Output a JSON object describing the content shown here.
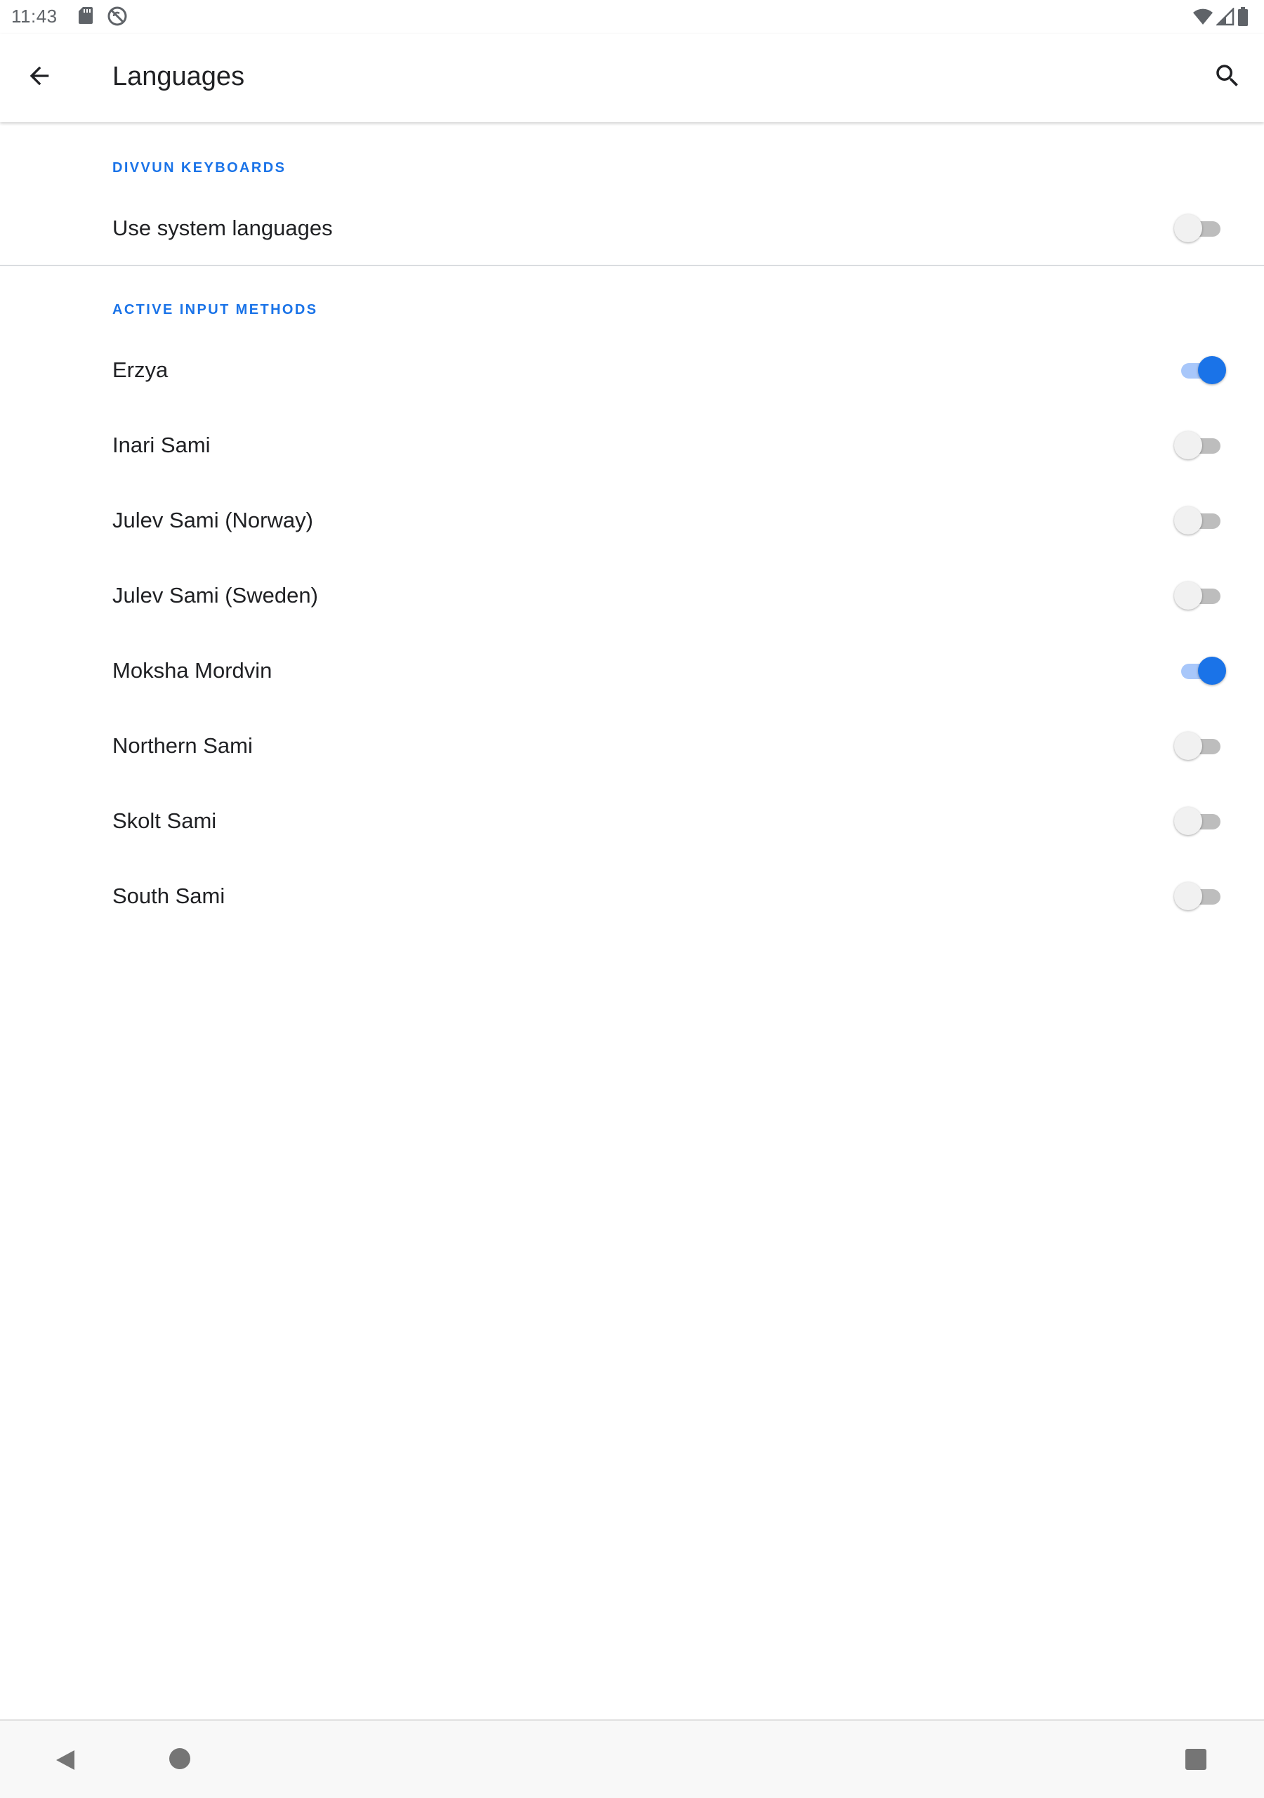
{
  "status_bar": {
    "time": "11:43",
    "left_icons": [
      "sd-card-icon",
      "sync-disabled-icon"
    ],
    "right_icons": [
      "wifi-icon",
      "cell-signal-icon",
      "battery-icon"
    ]
  },
  "app_bar": {
    "title": "Languages",
    "back_icon": "arrow-back-icon",
    "search_icon": "search-icon"
  },
  "sections": {
    "divvun": {
      "header": "DIVVUN KEYBOARDS",
      "items": [
        {
          "label": "Use system languages",
          "enabled": false
        }
      ]
    },
    "active": {
      "header": "ACTIVE INPUT METHODS",
      "items": [
        {
          "label": "Erzya",
          "enabled": true
        },
        {
          "label": "Inari Sami",
          "enabled": false
        },
        {
          "label": "Julev Sami (Norway)",
          "enabled": false
        },
        {
          "label": "Julev Sami (Sweden)",
          "enabled": false
        },
        {
          "label": "Moksha Mordvin",
          "enabled": true
        },
        {
          "label": "Northern Sami",
          "enabled": false
        },
        {
          "label": "Skolt Sami",
          "enabled": false
        },
        {
          "label": "South Sami",
          "enabled": false
        }
      ]
    }
  },
  "colors": {
    "accent": "#1a73e8",
    "accent_track": "#a8c7fa",
    "off_thumb": "#f1f1f1",
    "off_track": "#bdbdbd"
  },
  "nav_bar": {
    "icons": [
      "nav-back-icon",
      "nav-home-icon",
      "nav-recents-icon"
    ]
  }
}
